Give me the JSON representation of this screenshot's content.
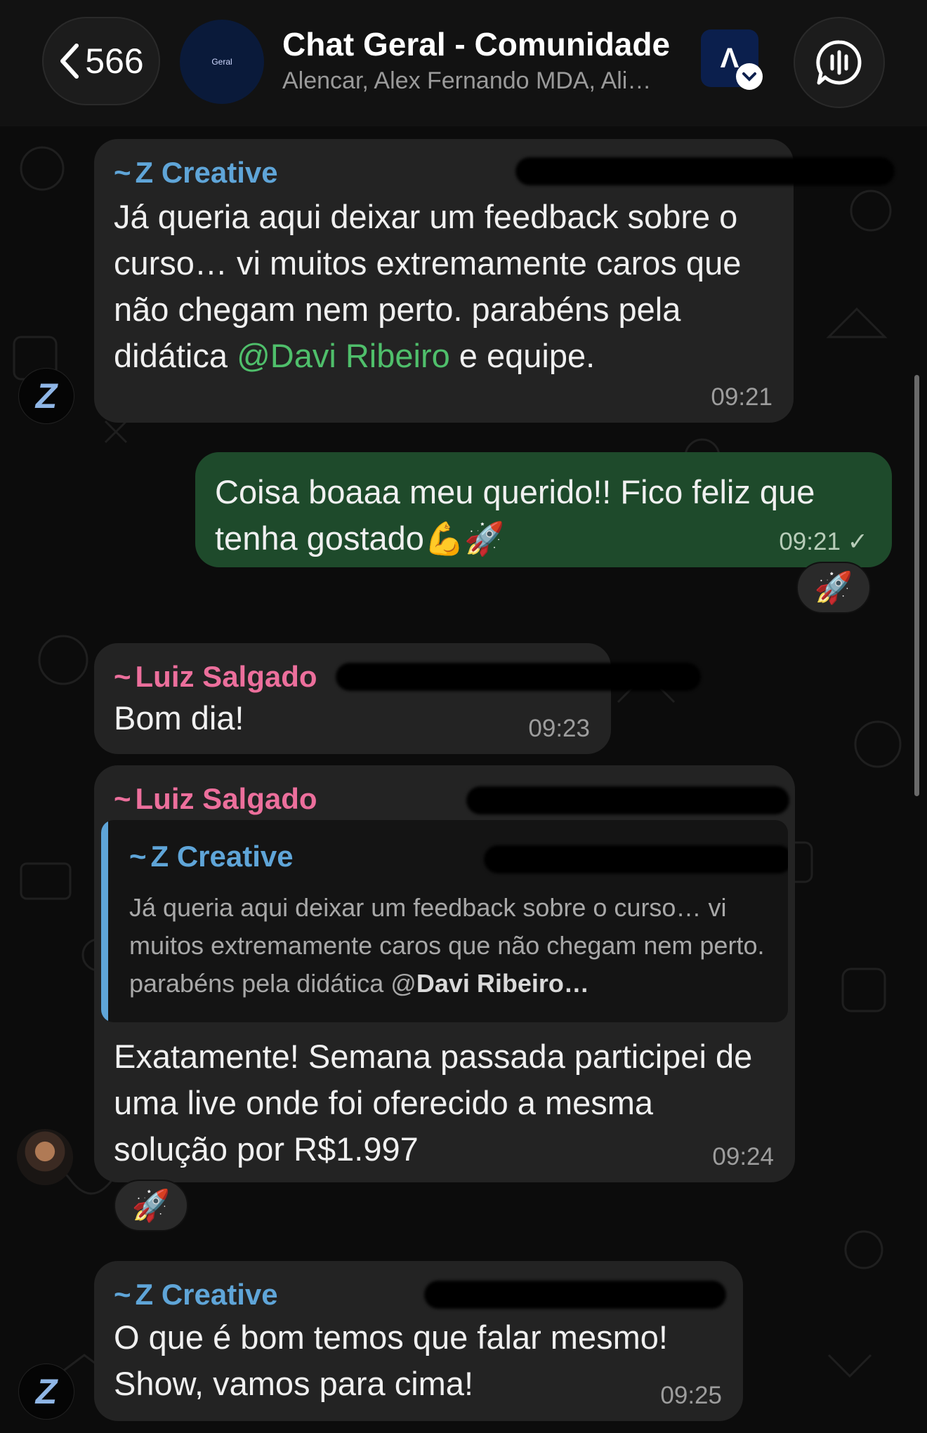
{
  "header": {
    "back_count": "566",
    "group_avatar_text": "Geral",
    "title": "Chat Geral - Comunidade",
    "subtitle": "Alencar, Alex Fernando MDA, Ali…",
    "community_badge_text": "Λ"
  },
  "messages": [
    {
      "sender": "Z Creative",
      "text_before": "Já queria aqui deixar um feedback sobre o curso… vi muitos extremamente caros que não chegam nem perto. parabéns pela didática ",
      "mention": "@Davi Ribeiro",
      "text_after": " e equipe.",
      "time": "09:21"
    },
    {
      "text": "Coisa boaaa meu querido!! Fico feliz que tenha gostado",
      "emoji": "💪🚀",
      "time": "09:21",
      "status": "✓",
      "reaction": "🚀"
    },
    {
      "sender": "Luiz Salgado",
      "text": "Bom dia!",
      "time": "09:23"
    },
    {
      "sender": "Luiz Salgado",
      "quote": {
        "sender": "Z Creative",
        "text": "Já queria aqui deixar um feedback sobre o curso… vi muitos extremamente caros que não chegam nem perto. parabéns pela didática @",
        "mention": "Davi Ribeiro…"
      },
      "text": "Exatamente! Semana passada participei de uma live onde foi oferecido a mesma solução por R$1.997",
      "time": "09:24",
      "reaction": "🚀"
    },
    {
      "sender": "Z Creative",
      "text": "O que é bom temos que falar mesmo! Show, vamos para cima!",
      "time": "09:25"
    }
  ],
  "avatars": {
    "z_creative": "Z"
  },
  "colors": {
    "incoming_bubble": "#232323",
    "outgoing_bubble": "#1e4a2b",
    "sender_blue": "#5fa5d8",
    "sender_pink": "#ec6f9c",
    "mention_green": "#4fbf6b"
  },
  "tilde": "~"
}
